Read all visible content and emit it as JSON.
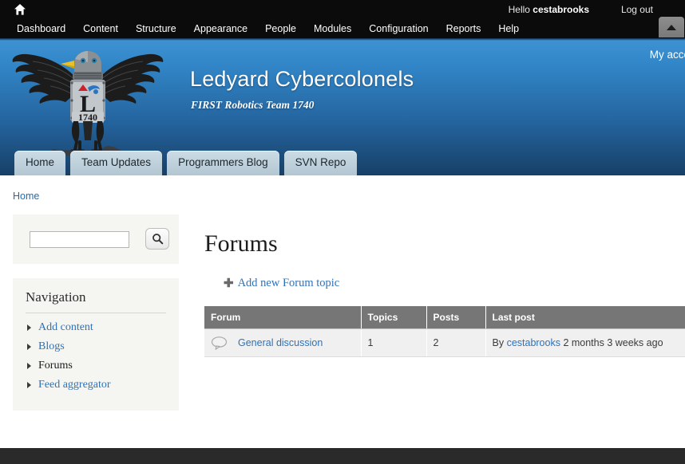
{
  "toolbar": {
    "home_icon": "home-icon",
    "greeting_prefix": "Hello ",
    "username": "cestabrooks",
    "logout_label": "Log out",
    "toggle_icon": "triangle-up-icon",
    "menu": [
      {
        "label": "Dashboard"
      },
      {
        "label": "Content"
      },
      {
        "label": "Structure"
      },
      {
        "label": "Appearance"
      },
      {
        "label": "People"
      },
      {
        "label": "Modules"
      },
      {
        "label": "Configuration"
      },
      {
        "label": "Reports"
      },
      {
        "label": "Help"
      }
    ]
  },
  "banner": {
    "site_title": "Ledyard Cybercolonels",
    "site_slogan": "FIRST Robotics Team 1740",
    "my_account_label": "My acco",
    "logo_alt": "eagle-shield-logo",
    "logo_shield_letter": "L",
    "logo_shield_number": "1740",
    "gradient_top": "#3f93d3",
    "gradient_bottom": "#174066"
  },
  "tabs": [
    {
      "label": "Home"
    },
    {
      "label": "Team Updates"
    },
    {
      "label": "Programmers Blog"
    },
    {
      "label": "SVN Repo"
    }
  ],
  "breadcrumb": {
    "home_label": "Home"
  },
  "sidebar": {
    "search": {
      "value": "",
      "placeholder": "",
      "button_icon": "search-icon"
    },
    "navigation": {
      "title": "Navigation",
      "items": [
        {
          "label": "Add content",
          "active": false
        },
        {
          "label": "Blogs",
          "active": false
        },
        {
          "label": "Forums",
          "active": true
        },
        {
          "label": "Feed aggregator",
          "active": false
        }
      ]
    }
  },
  "content": {
    "page_title": "Forums",
    "action_link": {
      "icon": "plus-icon",
      "label": "Add new Forum topic"
    },
    "table": {
      "headers": [
        "Forum",
        "Topics",
        "Posts",
        "Last post"
      ],
      "rows": [
        {
          "icon": "forum-bubble-icon",
          "forum": "General discussion",
          "topics": "1",
          "posts": "2",
          "last_post_prefix": "By ",
          "last_post_author": "cestabrooks",
          "last_post_time": " 2 months 3 weeks ago"
        }
      ]
    }
  },
  "colors": {
    "link": "#2e72ba",
    "table_header_bg": "#767676",
    "table_row_bg": "#f0f0f0",
    "sidebar_bg": "#f5f5f1",
    "footer_bg": "#2a2a2a",
    "toolbar_bg": "#0b0b0b"
  }
}
